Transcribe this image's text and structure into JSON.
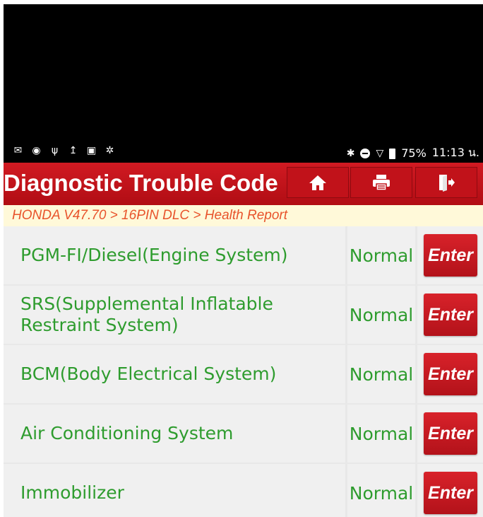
{
  "status_bar": {
    "left_icons": [
      "mail-icon",
      "chat-icon",
      "usb-icon",
      "upload-icon",
      "image-icon",
      "bluetooth-outline-icon"
    ],
    "battery_percent": "75%",
    "time": "11:13 น."
  },
  "header": {
    "title": "Diagnostic Trouble Code",
    "buttons": [
      "home-icon",
      "print-icon",
      "exit-icon"
    ],
    "accent_color": "#c8141c"
  },
  "breadcrumb": "HONDA V47.70 > 16PIN DLC > Health Report",
  "systems": [
    {
      "name": "PGM-FI/Diesel(Engine System)",
      "status": "Normal",
      "action": "Enter"
    },
    {
      "name": "SRS(Supplemental Inflatable Restraint System)",
      "status": "Normal",
      "action": "Enter"
    },
    {
      "name": "BCM(Body Electrical System)",
      "status": "Normal",
      "action": "Enter"
    },
    {
      "name": "Air Conditioning System",
      "status": "Normal",
      "action": "Enter"
    },
    {
      "name": "Immobilizer",
      "status": "Normal",
      "action": "Enter"
    }
  ],
  "colors": {
    "status_green": "#2e9c2e",
    "breadcrumb_orange": "#e8542c",
    "breadcrumb_bg": "#fff9d9"
  }
}
